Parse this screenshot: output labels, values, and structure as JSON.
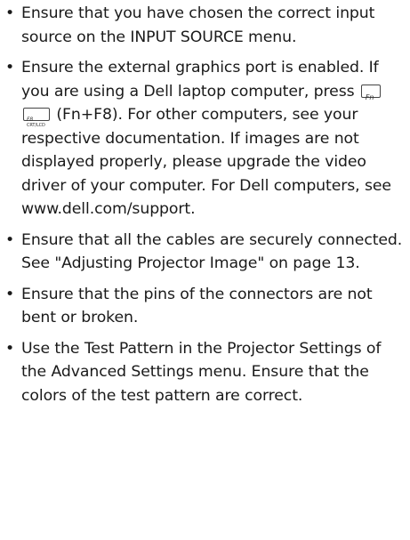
{
  "bullets": [
    {
      "text": "Ensure that you have chosen the correct input source on the INPUT SOURCE menu."
    },
    {
      "text_before_keys": "Ensure the external graphics port is enabled. If you are using a Dell laptop computer, press ",
      "key_fn": "Fn",
      "key_f8_top": "F8",
      "key_f8_bottom": "CRT/LCD",
      "text_after_keys": " (Fn+F8). For other computers, see your respective documentation. If images are not displayed properly, please upgrade the video driver of your computer. For Dell computers, see www.dell.com/support."
    },
    {
      "text": "Ensure that all the cables are securely connected. See \"Adjusting Projector Image\" on page 13."
    },
    {
      "text": "Ensure that the pins of the connectors are not bent or broken."
    },
    {
      "text": "Use the Test Pattern in the Projector Settings of the Advanced Settings menu. Ensure that the colors of the test pattern are correct."
    }
  ],
  "bullet_glyph": "•"
}
